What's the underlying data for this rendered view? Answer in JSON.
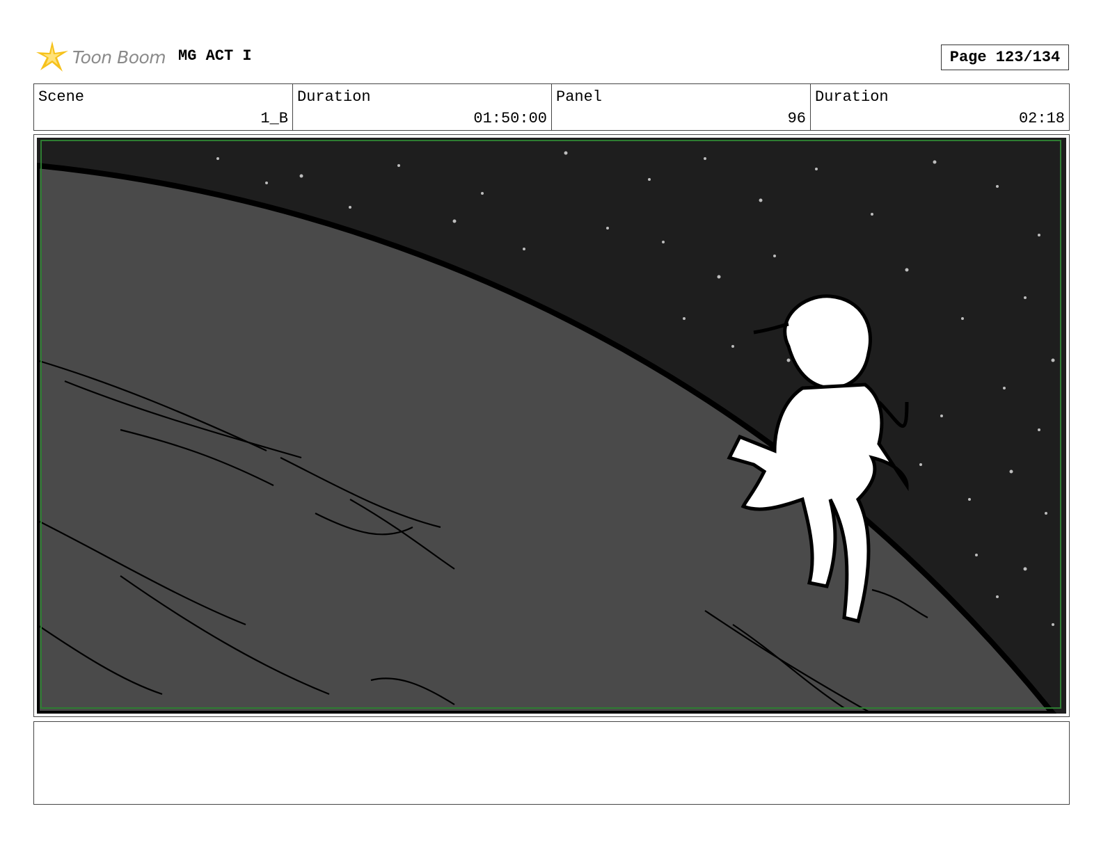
{
  "header": {
    "logo_text": "Toon Boom",
    "title": "MG ACT I",
    "page": "Page 123/134"
  },
  "info": {
    "scene_label": "Scene",
    "scene_value": "1_B",
    "duration_label": "Duration",
    "duration_value": "01:50:00",
    "panel_label": "Panel",
    "panel_value": "96",
    "panel_duration_label": "Duration",
    "panel_duration_value": "02:18"
  },
  "panel_image": {
    "description_icon": "storyboard-frame"
  },
  "notes": {
    "text": ""
  },
  "colors": {
    "space": "#1e1e1e",
    "planet": "#4a4a4a",
    "safe_frame": "#2e7d32",
    "logo_star": "#f6c21c"
  }
}
